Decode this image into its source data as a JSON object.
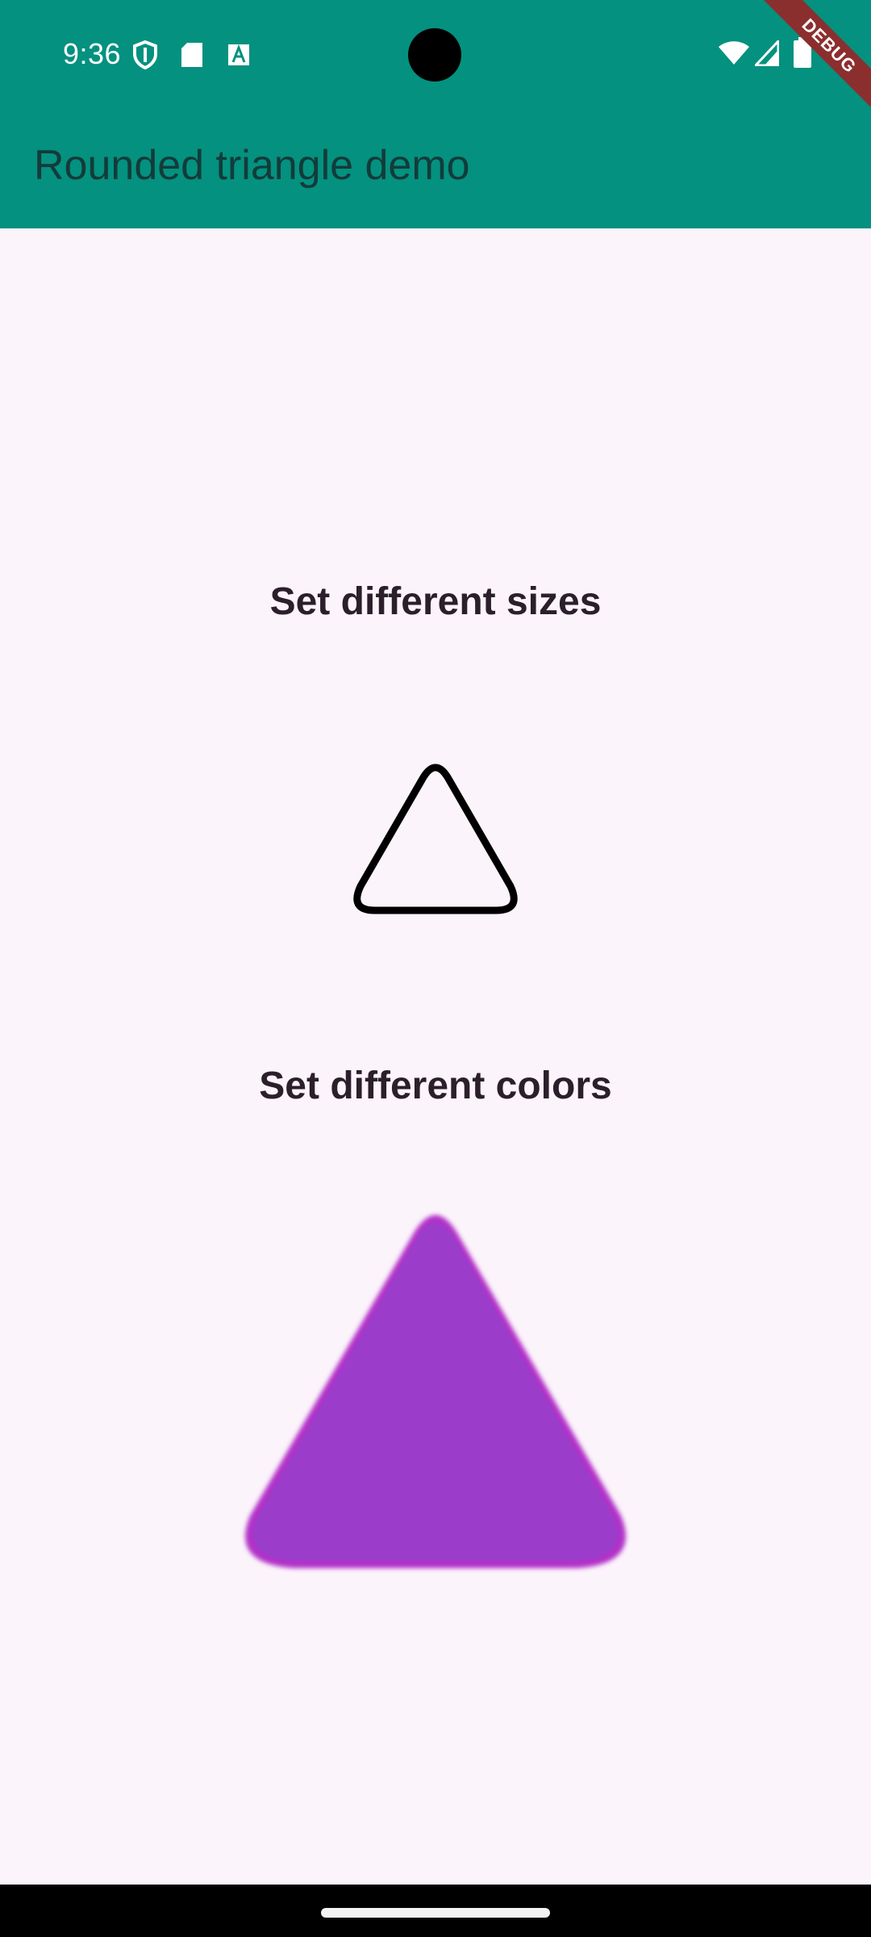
{
  "status_bar": {
    "time": "9:36",
    "icons_left": [
      "shield-icon",
      "sd-card-icon",
      "a-icon"
    ],
    "icons_right": [
      "wifi-icon",
      "signal-icon",
      "battery-icon"
    ]
  },
  "app_bar": {
    "title": "Rounded triangle demo",
    "debug_label": "DEBUG",
    "color": "#04917f"
  },
  "sections": [
    {
      "heading": "Set different sizes",
      "triangle": {
        "style": "outline",
        "stroke": "#000000",
        "fill": "#fcf4fb"
      }
    },
    {
      "heading": "Set different colors",
      "triangle": {
        "style": "filled",
        "fill": "#9c3ccb"
      }
    }
  ],
  "nav_bar": {
    "handle": "gesture-handle"
  }
}
